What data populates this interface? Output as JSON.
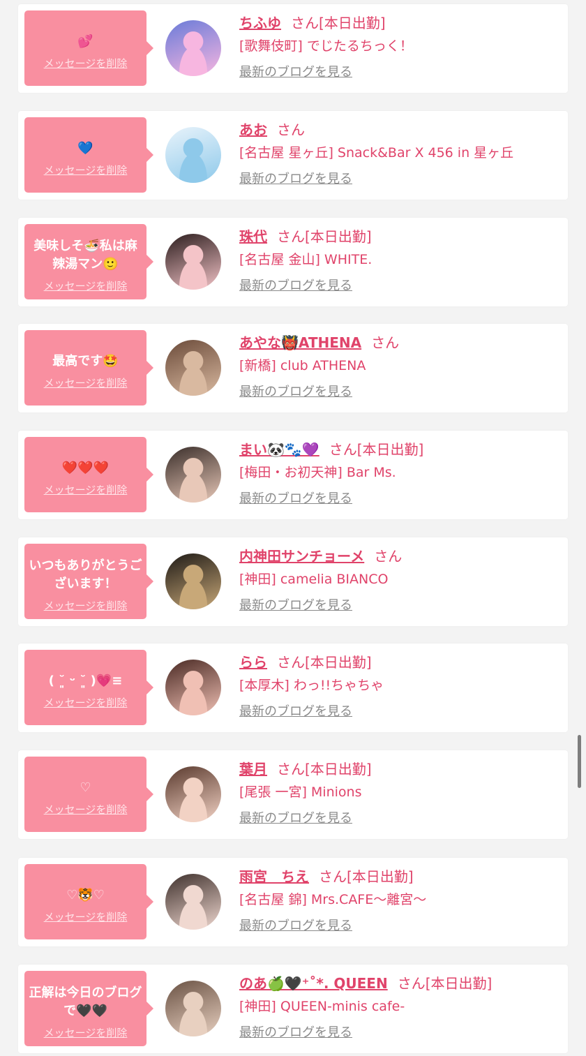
{
  "colors": {
    "accent": "#e0436a",
    "bubble": "#f98fa0",
    "background": "#f3f3f3",
    "card": "#ffffff",
    "blog_link": "#8a8a8a"
  },
  "items": [
    {
      "message": "💕",
      "delete_label": "メッセージを削除",
      "name": "ちふゆ",
      "san": "さん",
      "shift": "[本日出勤]",
      "shop": "[歌舞伎町] でじたるちっく！",
      "blog_link": "最新のブログを見る",
      "avatar_icon": "avatar-photo-icon",
      "avatar_colors": [
        "#f7b6e0",
        "#6a7bd8"
      ]
    },
    {
      "message": "💙",
      "delete_label": "メッセージを削除",
      "name": "あお",
      "san": "さん",
      "shift": "",
      "shop": "[名古屋 星ヶ丘] Snack&Bar X 456 in 星ヶ丘",
      "blog_link": "最新のブログを見る",
      "avatar_icon": "avatar-photo-icon",
      "avatar_colors": [
        "#8ec9ea",
        "#e8f3fb"
      ]
    },
    {
      "message": "美味しそ🍜私は麻辣湯マン🙂",
      "delete_label": "メッセージを削除",
      "name": "珠代",
      "san": "さん",
      "shift": "[本日出勤]",
      "shop": "[名古屋 金山] WHITE.",
      "blog_link": "最新のブログを見る",
      "avatar_icon": "avatar-photo-icon",
      "avatar_colors": [
        "#f4c4c8",
        "#2b1d1d"
      ]
    },
    {
      "message": "最高です🤩",
      "delete_label": "メッセージを削除",
      "name": "あやな👹ATHENA",
      "san": "さん",
      "shift": "",
      "shop": "[新橋] club ATHENA",
      "blog_link": "最新のブログを見る",
      "avatar_icon": "avatar-photo-icon",
      "avatar_colors": [
        "#d9b9a0",
        "#6b4b3a"
      ]
    },
    {
      "message": "❤️❤️❤️",
      "delete_label": "メッセージを削除",
      "name": "まい🐼🐾💜",
      "san": "さん",
      "shift": "[本日出勤]",
      "shop": "[梅田・お初天神] Bar Ms.",
      "blog_link": "最新のブログを見る",
      "avatar_icon": "avatar-photo-icon",
      "avatar_colors": [
        "#e8c8b8",
        "#3a2e2a"
      ]
    },
    {
      "message": "いつもありがとうございます！",
      "delete_label": "メッセージを削除",
      "name": "内神田サンチョーメ",
      "san": "さん",
      "shift": "",
      "shop": "[神田] camelia BIANCO",
      "blog_link": "最新のブログを見る",
      "avatar_icon": "avatar-photo-icon",
      "avatar_colors": [
        "#c8a878",
        "#1e1a16"
      ]
    },
    {
      "message": "( ˘͈ ᵕ ˘͈ )💗≡",
      "delete_label": "メッセージを削除",
      "name": "らら",
      "san": "さん",
      "shift": "[本日出勤]",
      "shop": "[本厚木] わっ!!ちゃちゃ",
      "blog_link": "最新のブログを見る",
      "avatar_icon": "avatar-photo-icon",
      "avatar_colors": [
        "#f0c0b4",
        "#4a2a24"
      ]
    },
    {
      "message": "♡",
      "delete_label": "メッセージを削除",
      "name": "葉月",
      "san": "さん",
      "shift": "[本日出勤]",
      "shop": "[尾張 一宮] Minions",
      "blog_link": "最新のブログを見る",
      "avatar_icon": "avatar-photo-icon",
      "avatar_colors": [
        "#f2d2c4",
        "#5a3a2e"
      ]
    },
    {
      "message": "♡🐯♡",
      "delete_label": "メッセージを削除",
      "name": "雨宮　ちえ",
      "san": "さん",
      "shift": "[本日出勤]",
      "shop": "[名古屋 錦] Mrs.CAFE〜離宮〜",
      "blog_link": "最新のブログを見る",
      "avatar_icon": "avatar-photo-icon",
      "avatar_colors": [
        "#f0d8d0",
        "#3e302c"
      ]
    },
    {
      "message": "正解は今日のブログで🖤🖤",
      "delete_label": "メッセージを削除",
      "name": "のあ🍏🖤⁺˚*. QUEEN",
      "san": "さん",
      "shift": "[本日出勤]",
      "shop": "[神田] QUEEN-minis cafe-",
      "blog_link": "最新のブログを見る",
      "avatar_icon": "avatar-photo-icon",
      "avatar_colors": [
        "#e8d0c0",
        "#6a5244"
      ]
    }
  ]
}
